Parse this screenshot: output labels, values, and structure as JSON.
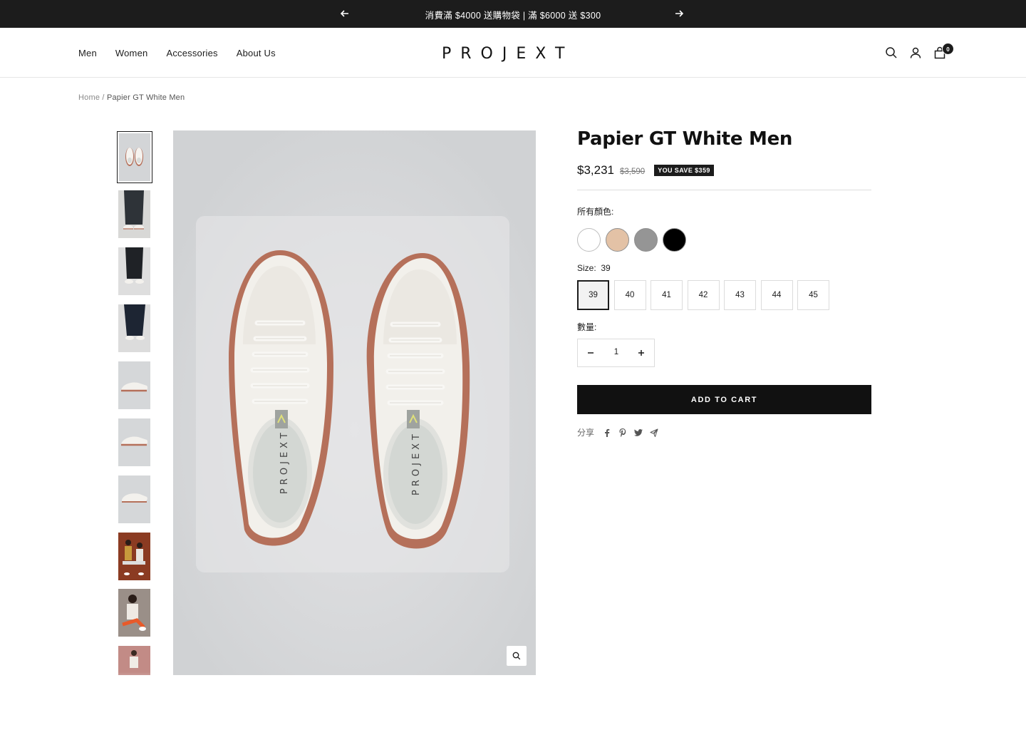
{
  "announcement": {
    "text": "消費滿 $4000 送購物袋 | 滿 $6000 送 $300",
    "prev_icon": "arrow-left-icon",
    "next_icon": "arrow-right-icon"
  },
  "header": {
    "nav": [
      "Men",
      "Women",
      "Accessories",
      "About Us"
    ],
    "logo": "PROJEXT",
    "cart_count": "0",
    "icons": [
      "search-icon",
      "account-icon",
      "cart-icon"
    ]
  },
  "breadcrumb": {
    "home": "Home",
    "separator": "/",
    "current": "Papier GT White Men"
  },
  "gallery": {
    "thumbnail_count": 10,
    "selected_index": 0
  },
  "product": {
    "title": "Papier GT White Men",
    "price": "$3,231",
    "compare_price": "$3,590",
    "save_badge": "YOU SAVE $359",
    "color_label": "所有顏色:",
    "colors": [
      {
        "name": "white",
        "hex": "#ffffff"
      },
      {
        "name": "beige",
        "hex": "#e3c2a6"
      },
      {
        "name": "grey",
        "hex": "#959595"
      },
      {
        "name": "black",
        "hex": "#000000"
      }
    ],
    "size_label": "Size:",
    "selected_size": "39",
    "sizes": [
      "39",
      "40",
      "41",
      "42",
      "43",
      "44",
      "45"
    ],
    "quantity_label": "數量:",
    "quantity": "1",
    "add_to_cart": "ADD TO CART",
    "share_label": "分享",
    "share_icons": [
      "facebook-icon",
      "pinterest-icon",
      "twitter-icon",
      "email-icon"
    ]
  },
  "colors": {
    "announcement_bg": "#1c1c1c",
    "primary": "#111111",
    "image_bg": "#d0d2d4",
    "sole": "#b5705a"
  }
}
